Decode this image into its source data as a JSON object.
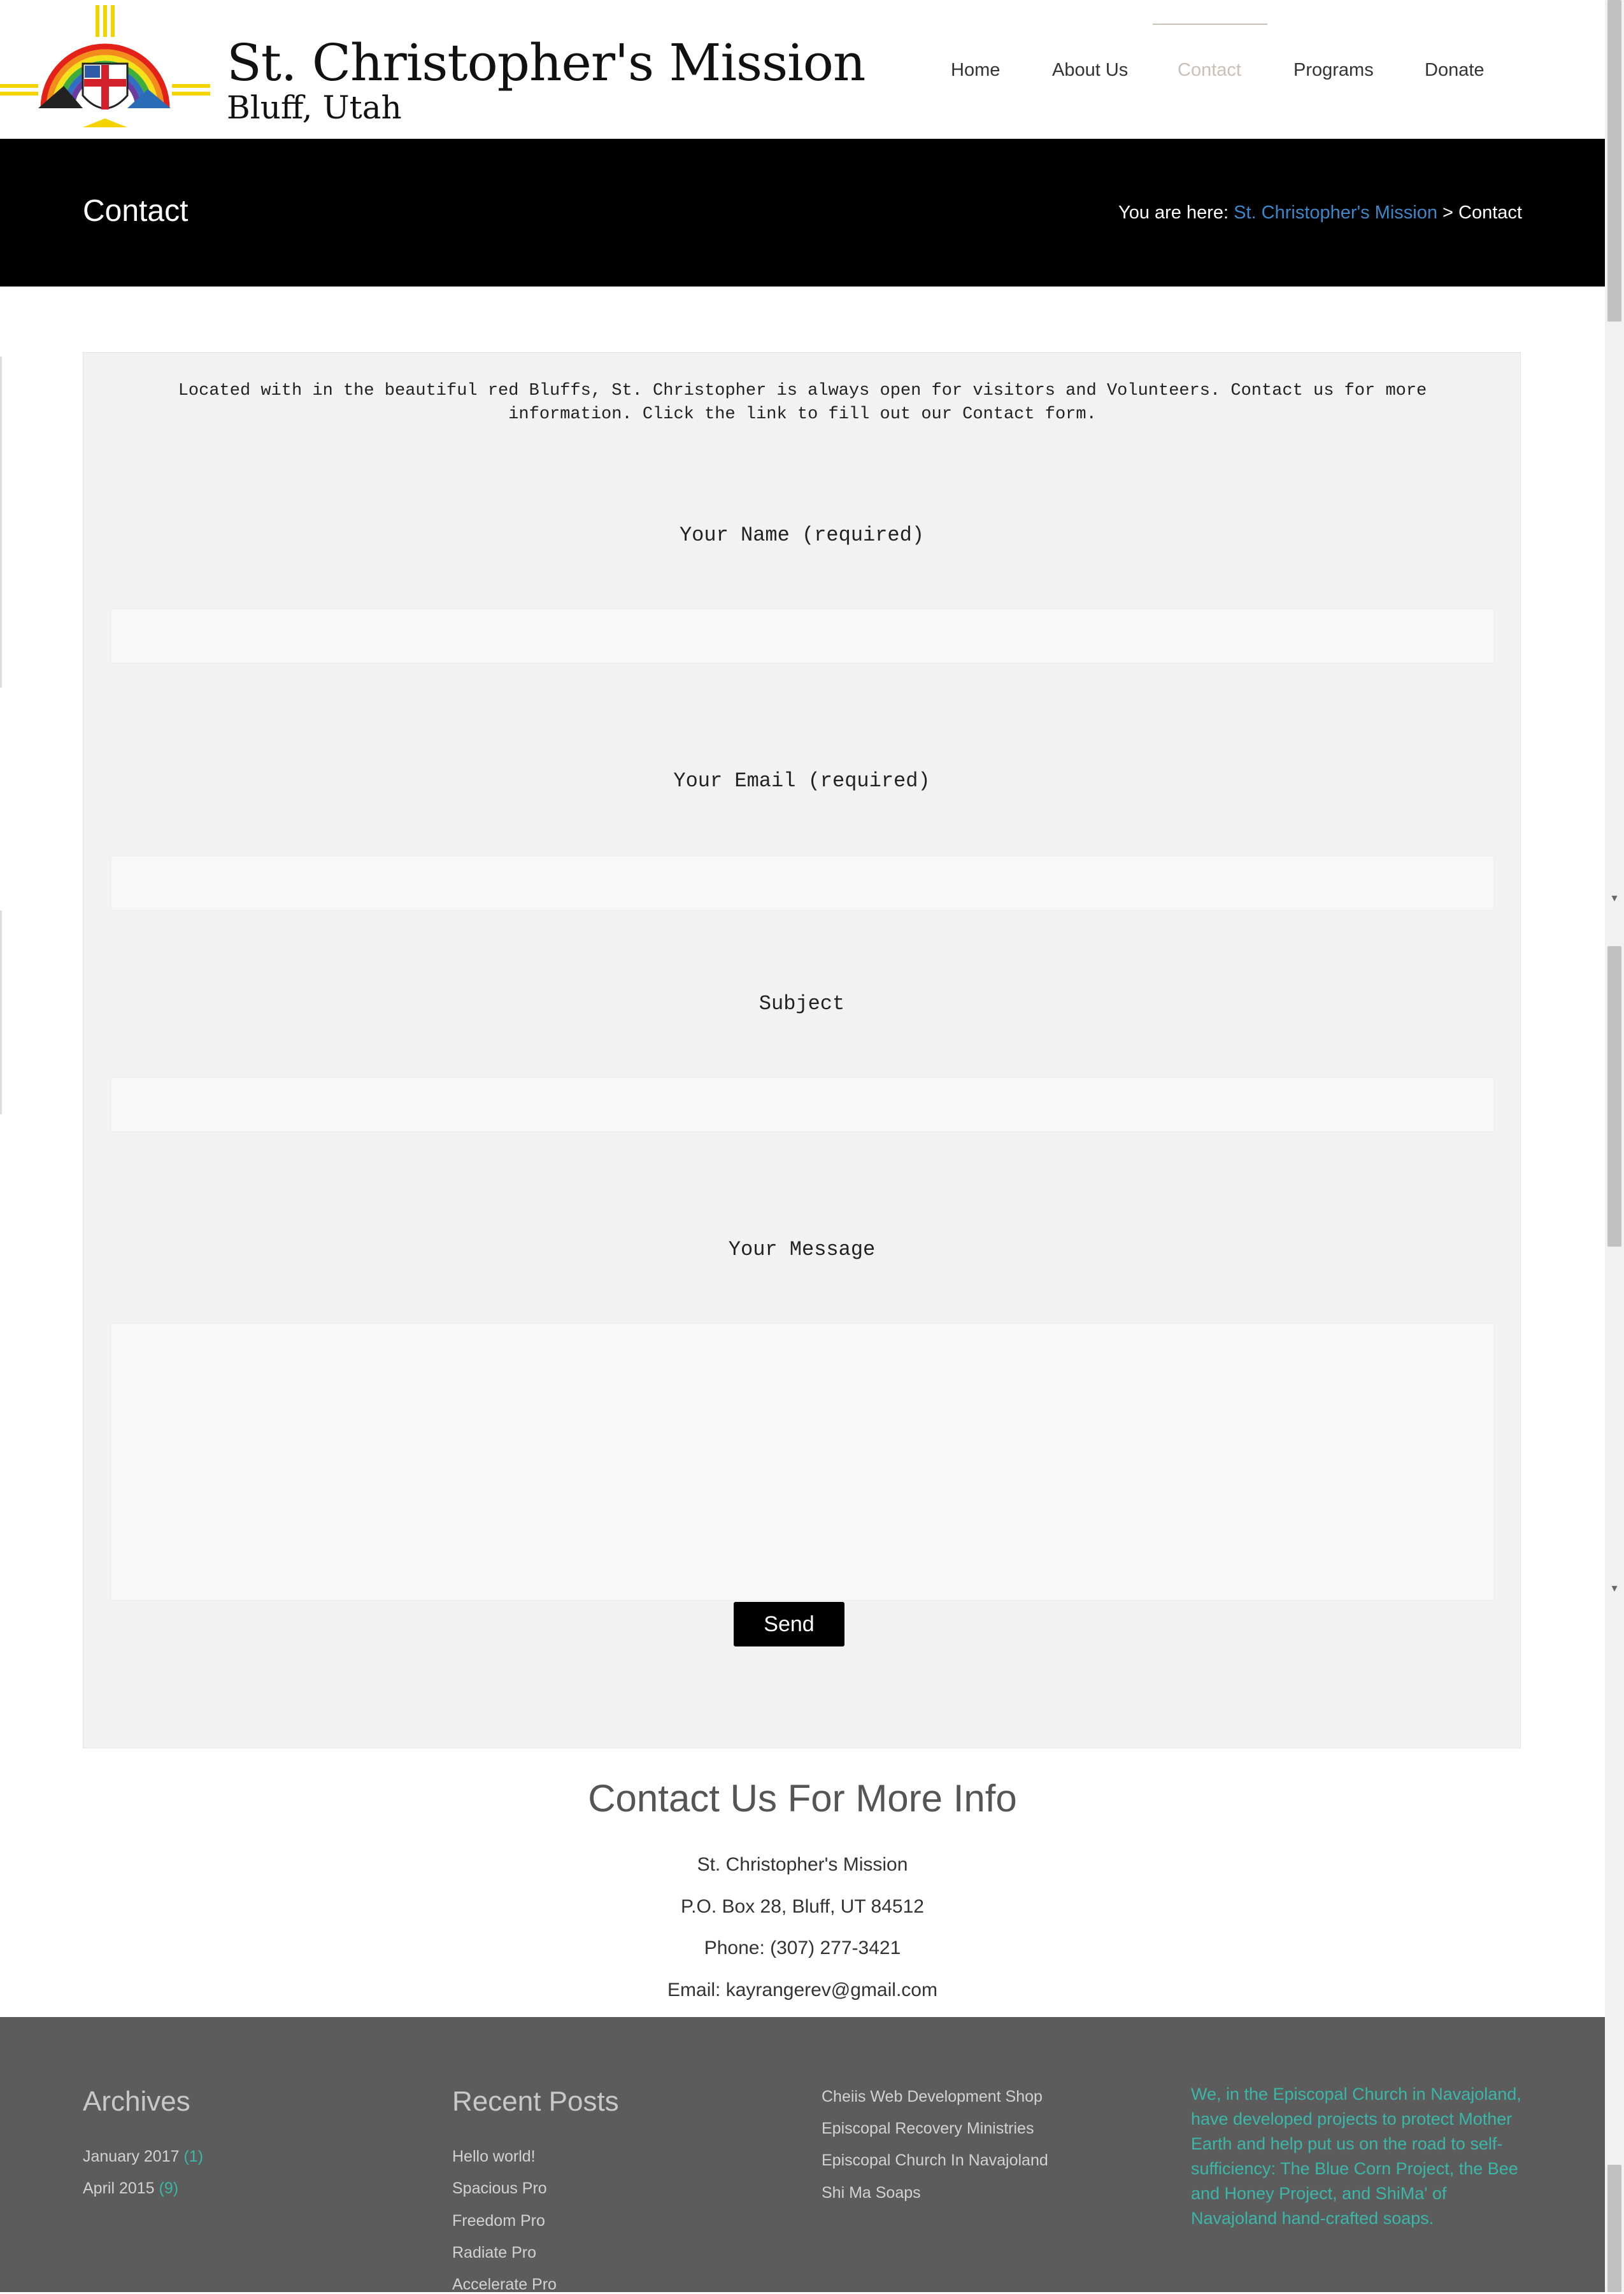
{
  "brand": {
    "title": "St. Christopher's Mission",
    "subtitle": "Bluff, Utah"
  },
  "nav": {
    "items": [
      {
        "label": "Home",
        "active": false
      },
      {
        "label": "About Us",
        "active": false
      },
      {
        "label": "Contact",
        "active": true
      },
      {
        "label": "Programs",
        "active": false
      },
      {
        "label": "Donate",
        "active": false
      }
    ]
  },
  "titlebar": {
    "title": "Contact",
    "breadcrumb_prefix": "You are here:",
    "breadcrumb_link": "St. Christopher's Mission",
    "breadcrumb_sep": ">",
    "breadcrumb_current": "Contact"
  },
  "form": {
    "intro": "Located with in the beautiful red Bluffs, St. Christopher is always open for visitors and Volunteers. Contact us for more information. Click the link to fill out our Contact form.",
    "name_label": "Your Name (required)",
    "name_value": "",
    "email_label": "Your Email (required)",
    "email_value": "",
    "subject_label": "Subject",
    "subject_value": "",
    "message_label": "Your Message",
    "message_value": "",
    "send_label": "Send"
  },
  "contact_info": {
    "heading": "Contact Us For More Info",
    "org": "St. Christopher's Mission",
    "address": "P.O. Box 28, Bluff, UT 84512",
    "phone": "Phone: (307) 277-3421",
    "email": "Email: kayrangerev@gmail.com"
  },
  "footer": {
    "archives_heading": "Archives",
    "archives": [
      {
        "label": "January 2017",
        "count": "(1)"
      },
      {
        "label": "April 2015",
        "count": "(9)"
      }
    ],
    "recent_heading": "Recent Posts",
    "recent_posts": [
      "Hello world!",
      "Spacious Pro",
      "Freedom Pro",
      "Radiate Pro",
      "Accelerate Pro"
    ],
    "links": [
      "Cheiis Web Development Shop",
      "Episcopal Recovery Ministries",
      "Episcopal Church In Navajoland",
      "Shi Ma Soaps"
    ],
    "blurb": "We, in the Episcopal Church in Navajoland, have developed projects to protect Mother Earth and help put us on the road to self-sufficiency: The Blue Corn Project, the Bee and Honey Project, and ShiMa' of Navajoland hand-crafted soaps."
  },
  "colors": {
    "titlebar_bg": "#000000",
    "breadcrumb_link": "#3f86c8",
    "nav_active": "#c9c1b8",
    "footer_bg": "#5c5c5c",
    "footer_accent": "#3ab7a8",
    "send_button_bg": "#000000"
  }
}
